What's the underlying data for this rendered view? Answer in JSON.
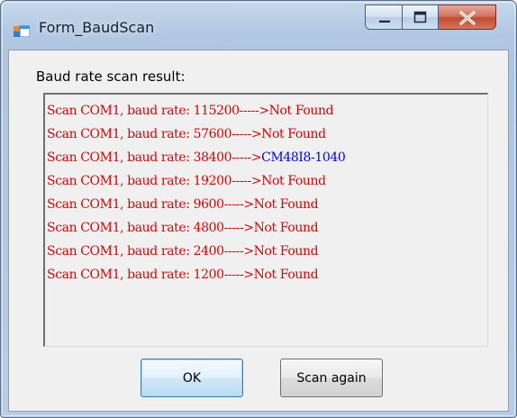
{
  "window": {
    "title": "Form_BaudScan",
    "icon": "form-app-icon",
    "caption_buttons": [
      "minimize-icon",
      "maximize-icon",
      "close-icon"
    ]
  },
  "group": {
    "label": "Baud rate scan result:"
  },
  "colors": {
    "not_found": "#e00000",
    "found": "#0000ff",
    "close_button": "#c14b32"
  },
  "results": [
    {
      "prefix": "Scan COM1, baud rate: 115200----->",
      "result": "Not Found",
      "color": "#e00000"
    },
    {
      "prefix": "Scan COM1, baud rate: 57600----->",
      "result": "Not Found",
      "color": "#e00000"
    },
    {
      "prefix": "Scan COM1, baud rate: 38400----->",
      "result": "CM48I8-1040",
      "color": "#0000ff"
    },
    {
      "prefix": "Scan COM1, baud rate: 19200----->",
      "result": "Not Found",
      "color": "#e00000"
    },
    {
      "prefix": "Scan COM1, baud rate: 9600----->",
      "result": "Not Found",
      "color": "#e00000"
    },
    {
      "prefix": "Scan COM1, baud rate: 4800----->",
      "result": "Not Found",
      "color": "#e00000"
    },
    {
      "prefix": "Scan COM1, baud rate: 2400----->",
      "result": "Not Found",
      "color": "#e00000"
    },
    {
      "prefix": "Scan COM1, baud rate: 1200----->",
      "result": "Not Found",
      "color": "#e00000"
    }
  ],
  "buttons": {
    "ok_label": "OK",
    "scan_again_label": "Scan again"
  }
}
